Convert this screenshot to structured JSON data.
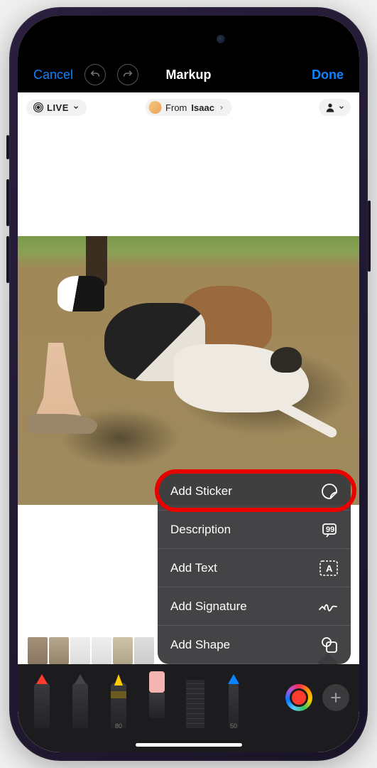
{
  "nav": {
    "cancel": "Cancel",
    "title": "Markup",
    "done": "Done"
  },
  "header": {
    "live_label": "LIVE",
    "from_prefix": "From ",
    "from_name": "Isaac"
  },
  "menu": {
    "items": [
      {
        "label": "Add Sticker",
        "icon": "sticker"
      },
      {
        "label": "Description",
        "icon": "description"
      },
      {
        "label": "Add Text",
        "icon": "text"
      },
      {
        "label": "Add Signature",
        "icon": "signature"
      },
      {
        "label": "Add Shape",
        "icon": "shape"
      }
    ]
  },
  "toolbar": {
    "tool_labels": {
      "marker": "80",
      "pencil": "50"
    }
  },
  "annotation": {
    "highlighted_menu_item": "Add Sticker"
  }
}
